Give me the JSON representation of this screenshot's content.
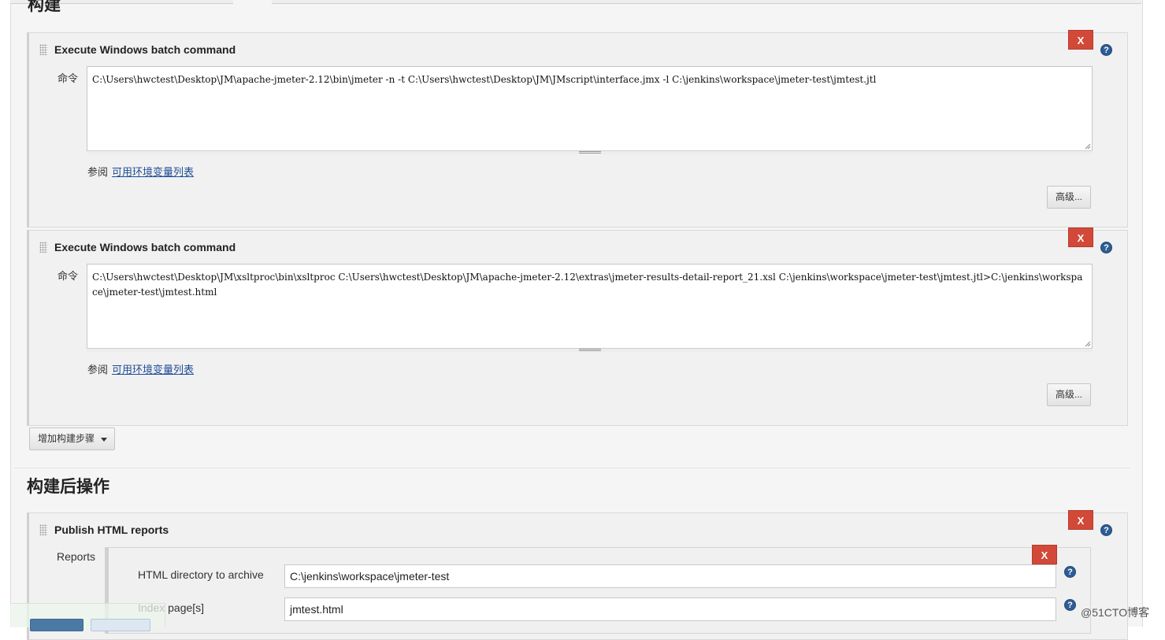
{
  "sections": {
    "build_title": "构建",
    "post_build_title": "构建后操作"
  },
  "steps": [
    {
      "title": "Execute Windows batch command",
      "command_label": "命令",
      "command": "C:\\Users\\hwctest\\Desktop\\JM\\apache-jmeter-2.12\\bin\\jmeter -n -t C:\\Users\\hwctest\\Desktop\\JM\\JMscript\\interface.jmx -l C:\\jenkins\\workspace\\jmeter-test\\jmtest.jtl",
      "see_label": "参阅",
      "env_link": "可用环境变量列表",
      "advanced": "高级...",
      "delete": "X"
    },
    {
      "title": "Execute Windows batch command",
      "command_label": "命令",
      "command": "C:\\Users\\hwctest\\Desktop\\JM\\xsltproc\\bin\\xsltproc C:\\Users\\hwctest\\Desktop\\JM\\apache-jmeter-2.12\\extras\\jmeter-results-detail-report_21.xsl C:\\jenkins\\workspace\\jmeter-test\\jmtest.jtl>C:\\jenkins\\workspace\\jmeter-test\\jmtest.html",
      "see_label": "参阅",
      "env_link": "可用环境变量列表",
      "advanced": "高级...",
      "delete": "X"
    }
  ],
  "add_step": "增加构建步骤",
  "publish": {
    "title": "Publish HTML reports",
    "delete": "X",
    "reports_label": "Reports",
    "report_delete": "X",
    "dir_label": "HTML directory to archive",
    "dir_value": "C:\\jenkins\\workspace\\jmeter-test",
    "index_label": "Index page[s]",
    "index_value": "jmtest.html"
  },
  "help_glyph": "?",
  "watermark": "@51CTO博客",
  "colors": {
    "delete_red": "#d24939",
    "help_blue": "#2e5d95",
    "link_blue": "#1f4c97",
    "save_blue": "#4a7aa4"
  }
}
